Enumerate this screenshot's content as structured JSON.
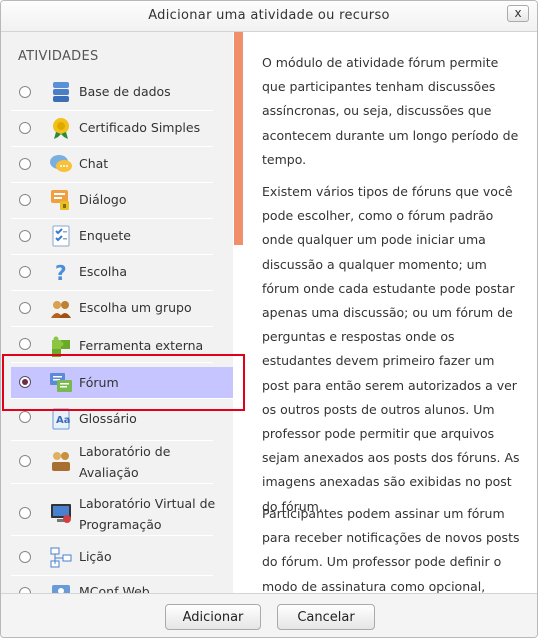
{
  "dialog": {
    "title": "Adicionar uma atividade ou recurso",
    "close_label": "x"
  },
  "options": {
    "section_title": "ATIVIDADES",
    "selected_label": "Fórum",
    "items": [
      {
        "label": "Base de dados",
        "icon": "database-icon"
      },
      {
        "label": "Certificado Simples",
        "icon": "certificate-icon"
      },
      {
        "label": "Chat",
        "icon": "chat-icon"
      },
      {
        "label": "Diálogo",
        "icon": "dialogue-icon"
      },
      {
        "label": "Enquete",
        "icon": "poll-icon"
      },
      {
        "label": "Escolha",
        "icon": "question-mark-icon"
      },
      {
        "label": "Escolha um grupo",
        "icon": "group-choice-icon"
      },
      {
        "label": "Ferramenta externa",
        "icon": "puzzle-icon"
      },
      {
        "label": "Fórum",
        "icon": "forum-icon"
      },
      {
        "label": "Glossário",
        "icon": "glossary-icon"
      },
      {
        "label": "Laboratório de Avaliação",
        "icon": "workshop-icon"
      },
      {
        "label": "Laboratório Virtual de Programação",
        "icon": "vpl-icon"
      },
      {
        "label": "Lição",
        "icon": "lesson-icon"
      },
      {
        "label": "MConf Web",
        "icon": "mconf-icon"
      }
    ]
  },
  "help": {
    "paragraphs": [
      "O módulo de atividade fórum permite que participantes tenham discussões assíncronas, ou seja, discussões que acontecem durante um longo período de tempo.",
      "Existem vários tipos de fóruns que você pode escolher, como o fórum padrão onde qualquer um pode iniciar uma discussão a qualquer momento; um fórum onde cada estudante pode postar apenas uma discussão; ou um fórum de perguntas e respostas onde os estudantes devem primeiro fazer um post para então serem autorizados a ver os outros posts de outros alunos. Um professor pode permitir que arquivos sejam anexados aos posts dos fóruns. As imagens anexadas são exibidas no post do fórum.",
      "Participantes podem assinar um fórum para receber notificações de novos posts do fórum. Um professor pode definir o modo de assinatura como opcional, forçado ou"
    ]
  },
  "footer": {
    "add_label": "Adicionar",
    "cancel_label": "Cancelar"
  },
  "colors": {
    "accent": "#f0906a",
    "selection": "#c7c5ff",
    "highlight_border": "#e0001a"
  }
}
